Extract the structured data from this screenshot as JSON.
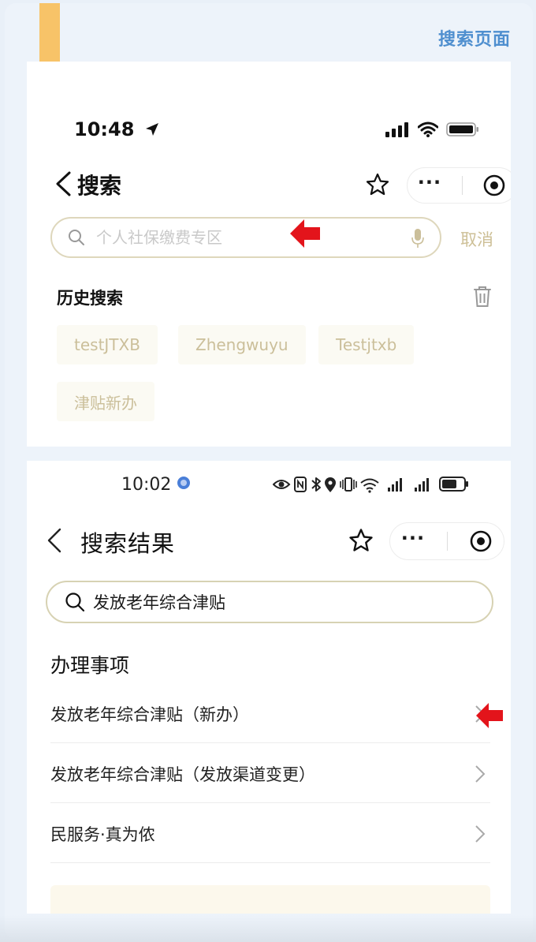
{
  "page": {
    "corner_title": "搜索页面",
    "accent_color": "#4f8fcf",
    "bookmark_color": "#f7c368"
  },
  "screen_a": {
    "status_time": "10:48",
    "nav_title": "搜索",
    "search": {
      "placeholder": "个人社保缴费专区",
      "cancel_label": "取消"
    },
    "history": {
      "title": "历史搜索",
      "items": [
        "testJTXB",
        "Zhengwuyu",
        "Testjtxb",
        "津贴新办"
      ]
    },
    "icons": [
      "location-arrow-icon",
      "signal-icon",
      "wifi-icon",
      "battery-icon",
      "back-chevron-icon",
      "star-icon",
      "more-dots-icon",
      "target-icon",
      "search-icon",
      "mic-icon",
      "trash-icon",
      "red-arrow-icon"
    ]
  },
  "screen_b": {
    "status_time": "10:02",
    "nav_title": "搜索结果",
    "search": {
      "value": "发放老年综合津贴"
    },
    "section_title": "办理事项",
    "results": [
      "发放老年综合津贴（新办）",
      "发放老年综合津贴（发放渠道变更）",
      "民服务·真为侬"
    ],
    "icons": [
      "eye-icon",
      "nfc-icon",
      "bluetooth-icon",
      "location-pin-icon",
      "vibrate-icon",
      "wifi-icon",
      "signal-4g-icon",
      "signal-5g-icon",
      "battery-icon",
      "back-chevron-icon",
      "star-icon",
      "more-dots-icon",
      "target-icon",
      "search-icon",
      "chevron-right-icon",
      "red-arrow-icon"
    ]
  }
}
